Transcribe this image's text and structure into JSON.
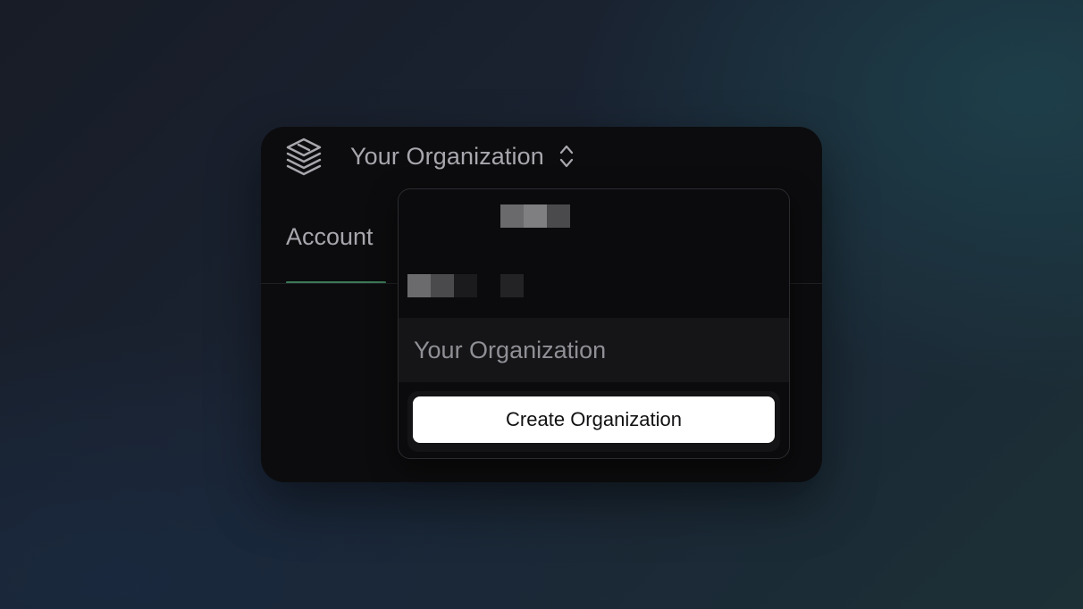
{
  "header": {
    "logo_icon": "stacked-layers-icon",
    "org_switcher": {
      "current_org": "Your Organization",
      "icon": "chevron-up-down-icon"
    }
  },
  "tabs": [
    {
      "label": "Account",
      "active": true
    }
  ],
  "dropdown": {
    "redacted_rows": 2,
    "items": [
      {
        "label": "Your Organization"
      }
    ],
    "create_button_label": "Create Organization"
  },
  "colors": {
    "card_background": "#0c0c0e",
    "tab_active_underline": "#3a7a55",
    "button_background": "#ffffff",
    "muted_text": "#a7a7ad"
  }
}
